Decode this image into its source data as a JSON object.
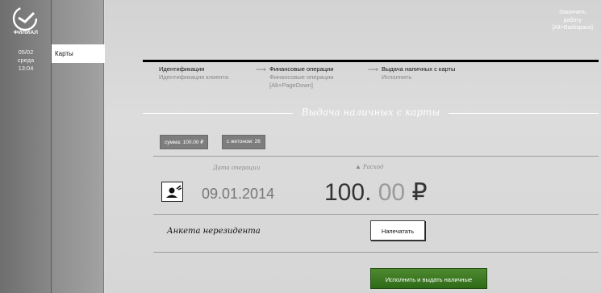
{
  "branch": {
    "logo_name": "sber-logo",
    "label": "ФИЛИАЛ"
  },
  "datetime": {
    "date": "05/02",
    "weekday": "среда",
    "time": "13:04"
  },
  "nav": {
    "active_item": "Карты"
  },
  "session": {
    "logout_line1": "Закончить",
    "logout_line2": "работу",
    "logout_hotkey": "[Alt+Backspace]"
  },
  "steps": [
    {
      "title": "Идентификация",
      "subtitle": "Идентификация клиента",
      "hotkey": ""
    },
    {
      "title": "Финансовые операции",
      "subtitle": "Финансовые операции",
      "hotkey": "[Alt+PageDown]"
    },
    {
      "title": "Выдача наличных с карты",
      "subtitle": "Исполнить",
      "hotkey": ""
    }
  ],
  "section": {
    "title": "Выдача наличных с карты"
  },
  "chips": [
    {
      "label": "сумма: 100.00 ₽"
    },
    {
      "label": "с жетоном: 26"
    }
  ],
  "operation": {
    "date_label": "Дата операции",
    "date_value": "09.01.2014",
    "amount_label": "Расход",
    "amount_int": "100",
    "amount_sep": ".",
    "amount_dec": " 00",
    "currency": " ₽",
    "icon": "operation-user-icon"
  },
  "anketa": {
    "label": "Анкета нерезидента",
    "print_label": "Напечатать"
  },
  "actions": {
    "execute_label": "Исполнить и выдать наличные"
  },
  "colors": {
    "execute": "#3f7d24",
    "dark_rail": "#7a7a7a",
    "nav_rail": "#9a9a9a",
    "main_bg": "#d9d9d9"
  }
}
